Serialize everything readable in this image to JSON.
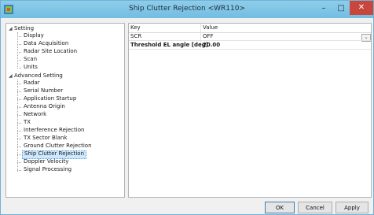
{
  "window": {
    "title": "Ship Clutter Rejection <WR110>",
    "minimize_glyph": "–",
    "maximize_glyph": "□",
    "close_glyph": "✕",
    "titlebar_color": "#7dc4e6",
    "close_color": "#c9463d"
  },
  "tree": {
    "setting": {
      "label": "Setting",
      "children": [
        "Display",
        "Data Acquisition",
        "Radar Site Location",
        "Scan",
        "Units"
      ]
    },
    "advanced": {
      "label": "Advanced Setting",
      "children": [
        "Radar",
        "Serial Number",
        "Application Startup",
        "Antenna Origin",
        "Network",
        "TX",
        "Interference Rejection",
        "TX Sector Blank",
        "Ground Clutter Rejection",
        "Ship Clutter Rejection",
        "Doppler Velocity",
        "Signal Processing"
      ]
    },
    "selected": "Ship Clutter Rejection",
    "expand_glyph": "◢"
  },
  "grid": {
    "headers": {
      "key": "Key",
      "value": "Value"
    },
    "rows": [
      {
        "key": "SCR",
        "value": "OFF"
      },
      {
        "key": "Threshold EL angle [deg]",
        "value": "20.00"
      }
    ],
    "dropdown_glyph": "⌄"
  },
  "buttons": {
    "ok": "OK",
    "cancel": "Cancel",
    "apply": "Apply"
  }
}
